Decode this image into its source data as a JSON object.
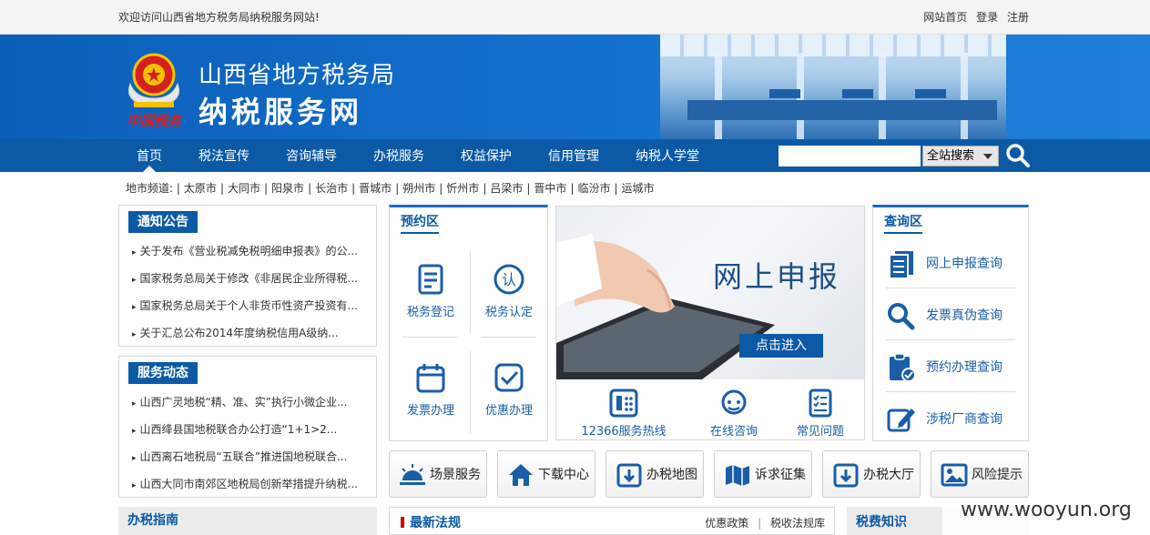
{
  "topbar": {
    "welcome": "欢迎访问山西省地方税务局纳税服务网站!",
    "home": "网站首页",
    "login": "登录",
    "register": "注册"
  },
  "header": {
    "org_name": "山西省地方税务局",
    "site_name": "纳税服务网",
    "emblem_text": "中国税务"
  },
  "nav": {
    "items": [
      "首页",
      "税法宣传",
      "咨询辅导",
      "办税服务",
      "权益保护",
      "信用管理",
      "纳税人学堂"
    ],
    "active": "首页"
  },
  "search": {
    "placeholder": "",
    "scope": "全站搜索"
  },
  "cities": {
    "label": "地市频道:",
    "list": [
      "太原市",
      "大同市",
      "阳泉市",
      "长治市",
      "晋城市",
      "朔州市",
      "忻州市",
      "吕梁市",
      "晋中市",
      "临汾市",
      "运城市"
    ]
  },
  "notice": {
    "title": "通知公告",
    "items": [
      "关于发布《营业税减免税明细申报表》的公...",
      "国家税务总局关于修改《非居民企业所得税...",
      "国家税务总局关于个人非货币性资产投资有...",
      "关于汇总公布2014年度纳税信用A级纳..."
    ]
  },
  "news": {
    "title": "服务动态",
    "items": [
      "山西广灵地税“精、准、实”执行小微企业...",
      "山西绛县国地税联合办公打造“1+1>2...",
      "山西离石地税局“五联合”推进国地税联合...",
      "山西大同市南郊区地税局创新举措提升纳税..."
    ]
  },
  "booking": {
    "title": "预约区",
    "items": [
      "税务登记",
      "税务认定",
      "发票办理",
      "优惠办理"
    ]
  },
  "promo": {
    "title": "网上申报",
    "button": "点击进入",
    "footer_items": [
      "12366服务热线",
      "在线咨询",
      "常见问题"
    ]
  },
  "query": {
    "title": "查询区",
    "items": [
      "网上申报查询",
      "发票真伪查询",
      "预约办理查询",
      "涉税厂商查询"
    ]
  },
  "quick_links": [
    "场景服务",
    "下载中心",
    "办税地图",
    "诉求征集",
    "办税大厅",
    "风险提示"
  ],
  "bottom": {
    "guide": "办税指南",
    "law_title": "最新法规",
    "law_links": [
      "优惠政策",
      "税收法规库"
    ],
    "tax_knowledge": "税费知识"
  },
  "watermark": "www.wooyun.org",
  "colors": {
    "primary_blue": "#0c5aa6",
    "banner_blue": "#1571cf",
    "accent_red": "#cc0000"
  }
}
